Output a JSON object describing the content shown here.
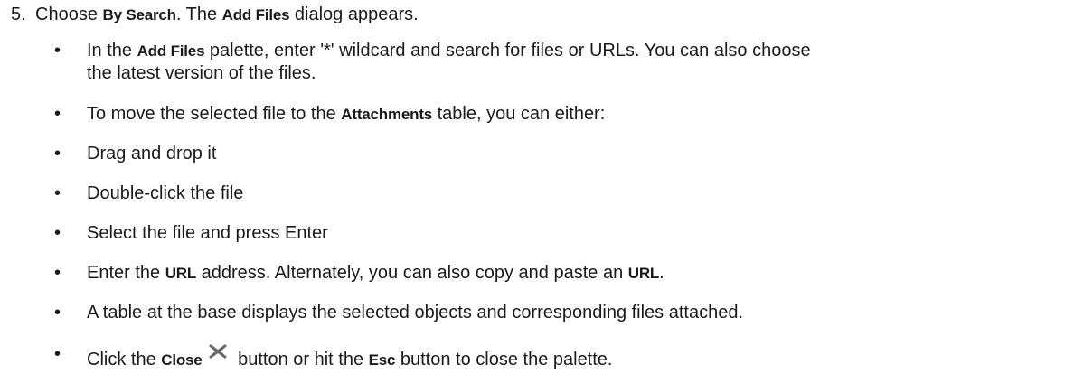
{
  "step": {
    "number": "5.",
    "text_a": "Choose ",
    "bold_a": "By Search",
    "text_b": ". The ",
    "bold_b": "Add Files",
    "text_c": " dialog appears."
  },
  "bullets": {
    "b1": {
      "text_a": "In the ",
      "bold_a": "Add Files",
      "text_b": " palette, enter '*' wildcard and search for files or URLs. You can also choose",
      "text_c": "the latest version of the files."
    },
    "b2": {
      "text_a": "To move the selected file to the ",
      "bold_a": "Attachments",
      "text_b": " table, you can either:"
    },
    "b3": {
      "text": "Drag and drop it"
    },
    "b4": {
      "text": "Double-click the file"
    },
    "b5": {
      "text": "Select the file and press Enter"
    },
    "b6": {
      "text_a": "Enter the ",
      "bold_a": "URL",
      "text_b": " address. Alternately, you can also copy and paste an ",
      "bold_b": "URL",
      "text_c": "."
    },
    "b7": {
      "text": "A table at the base displays the selected objects and corresponding files attached."
    },
    "b8": {
      "text_a": "Click the ",
      "bold_a": "Close",
      "icon": "close-x-icon",
      "text_b": " button or hit the ",
      "bold_b": "Esc",
      "text_c": " button to close the palette."
    }
  },
  "bullet_glyph": "•",
  "colors": {
    "text": "#1a1a1a",
    "icon": "#6b6b6b"
  }
}
